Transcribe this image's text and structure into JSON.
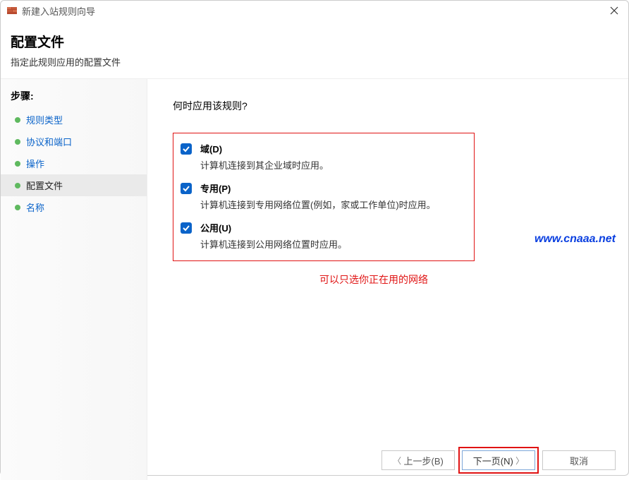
{
  "window": {
    "title": "新建入站规则向导"
  },
  "header": {
    "title": "配置文件",
    "subtitle": "指定此规则应用的配置文件"
  },
  "sidebar": {
    "steps_label": "步骤:",
    "items": [
      {
        "label": "规则类型"
      },
      {
        "label": "协议和端口"
      },
      {
        "label": "操作"
      },
      {
        "label": "配置文件"
      },
      {
        "label": "名称"
      }
    ]
  },
  "main": {
    "question": "何时应用该规则?",
    "options": [
      {
        "title": "域(D)",
        "desc": "计算机连接到其企业域时应用。"
      },
      {
        "title": "专用(P)",
        "desc": "计算机连接到专用网络位置(例如，家或工作单位)时应用。"
      },
      {
        "title": "公用(U)",
        "desc": "计算机连接到公用网络位置时应用。"
      }
    ],
    "red_note": "可以只选你正在用的网络",
    "watermark": "www.cnaaa.net"
  },
  "footer": {
    "back": "上一步(B)",
    "next": "下一页(N)",
    "cancel": "取消"
  }
}
